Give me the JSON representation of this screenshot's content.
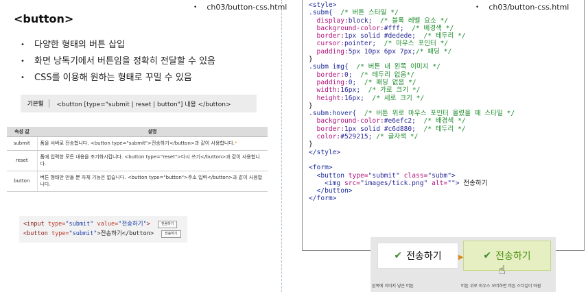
{
  "left": {
    "filename": "ch03/button-css.html",
    "title": "<button>",
    "bullets": [
      "다양한 형태의 버튼 삽입",
      "화면 낭독기에서 버튼임을 정확히 전달할 수 있음",
      "CSS를 이용해 원하는 형태로 꾸밀 수 있음"
    ],
    "syntax": {
      "tag": "기본형",
      "code": "<button [type=\"submit | reset | button\"] 내용 </button>"
    },
    "table": {
      "headers": [
        "속성 값",
        "설명"
      ],
      "rows": [
        {
          "key": "submit",
          "desc": "폼을 서버로 전송합니다. <button type=\"submit\">전송하기</button>과 같이 사용합니다.",
          "star": "*"
        },
        {
          "key": "reset",
          "desc": "폼에 입력한 모든 내용을 초기화시킵니다. <button type=\"reset\">다시 쓰기</button>과 같이 사용합니다."
        },
        {
          "key": "button",
          "desc": "버튼 형태만 만들 뿐 자체 기능은 없습니다. <button type=\"button\">주소 입력</button>과 같이 사용합니다."
        }
      ]
    },
    "example": {
      "line1": {
        "open": "<input ",
        "attr1": "type=",
        "val1": "\"submit\"",
        "attr2": " value=",
        "val2": "\"전송하기\"",
        "close": ">",
        "mini": "전송하기"
      },
      "line2": {
        "open": "<button ",
        "attr1": "type=",
        "val1": "\"submit\"",
        "text": ">전송하기</button>",
        "mini": "전송하기"
      }
    }
  },
  "right": {
    "filename": "ch03/button-css.html",
    "code_lines": [
      [
        {
          "c": "c-tag",
          "t": "<style>"
        }
      ],
      [
        {
          "c": "c-sel",
          "t": ".subm{"
        },
        {
          "c": "c-cm",
          "t": "  /* 버튼 스타일 */"
        }
      ],
      [
        {
          "c": "c-prop",
          "t": "  display:"
        },
        {
          "c": "c-val",
          "t": "block;"
        },
        {
          "c": "c-cm",
          "t": "  /* 블록 레벨 요소 */"
        }
      ],
      [
        {
          "c": "c-prop",
          "t": "  background-color:"
        },
        {
          "c": "c-val",
          "t": "#fff;"
        },
        {
          "c": "c-cm",
          "t": "  /* 배경색 */"
        }
      ],
      [
        {
          "c": "c-prop",
          "t": "  border:"
        },
        {
          "c": "c-val",
          "t": "1px solid #dedede;"
        },
        {
          "c": "c-cm",
          "t": "  /* 테두리 */"
        }
      ],
      [
        {
          "c": "c-prop",
          "t": "  cursor:"
        },
        {
          "c": "c-val",
          "t": "pointer;"
        },
        {
          "c": "c-cm",
          "t": "  /* 마우스 포인터 */"
        }
      ],
      [
        {
          "c": "c-prop",
          "t": "  padding:"
        },
        {
          "c": "c-val",
          "t": "5px 10px 6px 7px;"
        },
        {
          "c": "c-cm",
          "t": "/* 패딩 */"
        }
      ],
      [
        {
          "c": "c-punc",
          "t": "}"
        }
      ],
      [
        {
          "c": "c-sel",
          "t": ".subm img{"
        },
        {
          "c": "c-cm",
          "t": "  /* 버튼 내 왼쪽 이미지 */"
        }
      ],
      [
        {
          "c": "c-prop",
          "t": "  border:"
        },
        {
          "c": "c-val",
          "t": "0;"
        },
        {
          "c": "c-cm",
          "t": "  /* 테두리 없음*/"
        }
      ],
      [
        {
          "c": "c-prop",
          "t": "  padding:"
        },
        {
          "c": "c-val",
          "t": "0;"
        },
        {
          "c": "c-cm",
          "t": "  /* 패딩 없음 */"
        }
      ],
      [
        {
          "c": "c-prop",
          "t": "  width:"
        },
        {
          "c": "c-val",
          "t": "16px;"
        },
        {
          "c": "c-cm",
          "t": "  /* 가로 크기 */"
        }
      ],
      [
        {
          "c": "c-prop",
          "t": "  height:"
        },
        {
          "c": "c-val",
          "t": "16px;"
        },
        {
          "c": "c-cm",
          "t": "  /* 세로 크기 */"
        }
      ],
      [
        {
          "c": "c-punc",
          "t": "}"
        }
      ],
      [
        {
          "c": "c-sel",
          "t": ".subm:hover{"
        },
        {
          "c": "c-cm",
          "t": "  /* 버튼 위로 마우스 포인터 올렸을 때 스타일 */"
        }
      ],
      [
        {
          "c": "c-prop",
          "t": "  background-color:"
        },
        {
          "c": "c-val",
          "t": "#e6efc2;"
        },
        {
          "c": "c-cm",
          "t": "  /* 배경색 */"
        }
      ],
      [
        {
          "c": "c-prop",
          "t": "  border:"
        },
        {
          "c": "c-val",
          "t": "1px solid #c6d880;"
        },
        {
          "c": "c-cm",
          "t": "  /* 테두리 */"
        }
      ],
      [
        {
          "c": "c-prop",
          "t": "  color:"
        },
        {
          "c": "c-val",
          "t": "#529215;"
        },
        {
          "c": "c-cm",
          "t": " /* 글자색 */"
        }
      ],
      [
        {
          "c": "c-punc",
          "t": "}"
        }
      ],
      [
        {
          "c": "c-tag",
          "t": "</style>"
        }
      ],
      [
        {
          "c": "c-punc",
          "t": " "
        }
      ],
      [
        {
          "c": "c-tag",
          "t": "<form>"
        }
      ],
      [
        {
          "c": "c-tag",
          "t": "  <button "
        },
        {
          "c": "c-attr",
          "t": "type="
        },
        {
          "c": "c-str",
          "t": "\"submit\""
        },
        {
          "c": "c-attr",
          "t": " class="
        },
        {
          "c": "c-str",
          "t": "\"subm\""
        },
        {
          "c": "c-tag",
          "t": ">"
        }
      ],
      [
        {
          "c": "c-tag",
          "t": "    <img "
        },
        {
          "c": "c-attr",
          "t": "src="
        },
        {
          "c": "c-str",
          "t": "\"images/tick.png\""
        },
        {
          "c": "c-attr",
          "t": " alt="
        },
        {
          "c": "c-str",
          "t": "\"\""
        },
        {
          "c": "c-tag",
          "t": ">"
        },
        {
          "c": "c-txt",
          "t": " 전송하기"
        }
      ],
      [
        {
          "c": "c-tag",
          "t": "  </button>"
        }
      ],
      [
        {
          "c": "c-tag",
          "t": "</form>"
        }
      ]
    ],
    "demo": {
      "check": "✔",
      "button_label": "전송하기",
      "hover_label": "전송하기",
      "arrow": "▶",
      "hand": "☝",
      "caption_left": "왼쪽에 이미지 넣은 버튼",
      "caption_right": "버튼 위로 마우스 오버하면 버튼 스타일이 바뀜"
    }
  }
}
